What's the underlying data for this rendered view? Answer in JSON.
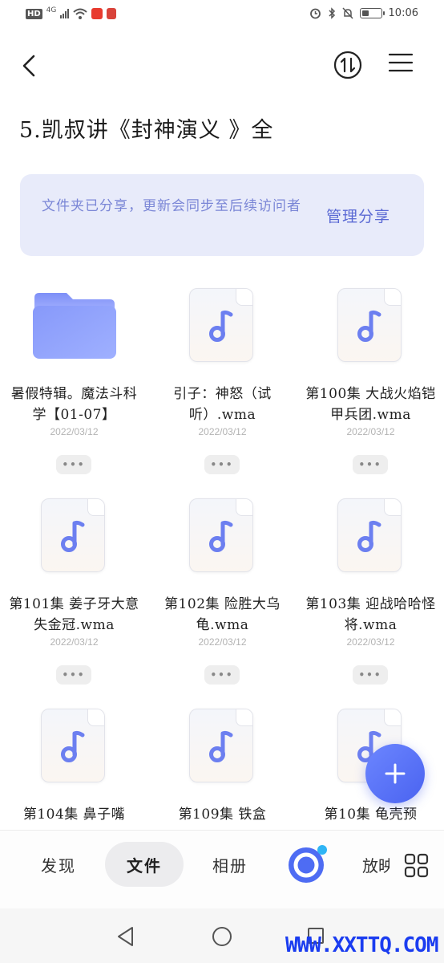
{
  "status_bar": {
    "badge": "HD",
    "network": "4G",
    "time": "10:06",
    "battery_level": 0.35
  },
  "header": {
    "back_icon": "chevron-left-icon",
    "sort_icon": "sort-swap-icon",
    "menu_icon": "hamburger-icon",
    "title": "5.凯叔讲《封神演义 》全"
  },
  "banner": {
    "text": "文件夹已分享，更新会同步至后续访问者",
    "action": "管理分享"
  },
  "files": [
    {
      "type": "folder",
      "name": "暑假特辑。魔法斗科学【01-07】",
      "date": "2022/03/12",
      "more": "•••"
    },
    {
      "type": "audio",
      "name": "引子：神怒（试听）.wma",
      "date": "2022/03/12",
      "more": "•••"
    },
    {
      "type": "audio",
      "name": "第100集 大战火焰铠甲兵团.wma",
      "date": "2022/03/12",
      "more": "•••"
    },
    {
      "type": "audio",
      "name": "第101集 姜子牙大意失金冠.wma",
      "date": "2022/03/12",
      "more": "•••"
    },
    {
      "type": "audio",
      "name": "第102集 险胜大乌龟.wma",
      "date": "2022/03/12",
      "more": "•••"
    },
    {
      "type": "audio",
      "name": "第103集 迎战哈哈怪将.wma",
      "date": "2022/03/12",
      "more": "•••"
    },
    {
      "type": "audio",
      "name": "第104集 鼻子嘴",
      "date": "",
      "more": ""
    },
    {
      "type": "audio",
      "name": "第109集 铁盒",
      "date": "",
      "more": ""
    },
    {
      "type": "audio",
      "name": "第10集 龟壳预",
      "date": "",
      "more": ""
    }
  ],
  "fab": {
    "icon": "plus-icon"
  },
  "tabs": {
    "discover": "发现",
    "files": "文件",
    "album": "相册",
    "center_icon": "cloud-orbit-icon",
    "clipped": "放映",
    "grid_icon": "grid-icon"
  },
  "watermark": "WWW.XXTTQ.COM",
  "colors": {
    "accent": "#5a69d4",
    "banner_bg": "#e8ebfa",
    "fab": "#5871f7",
    "watermark": "#1a3cf0"
  }
}
